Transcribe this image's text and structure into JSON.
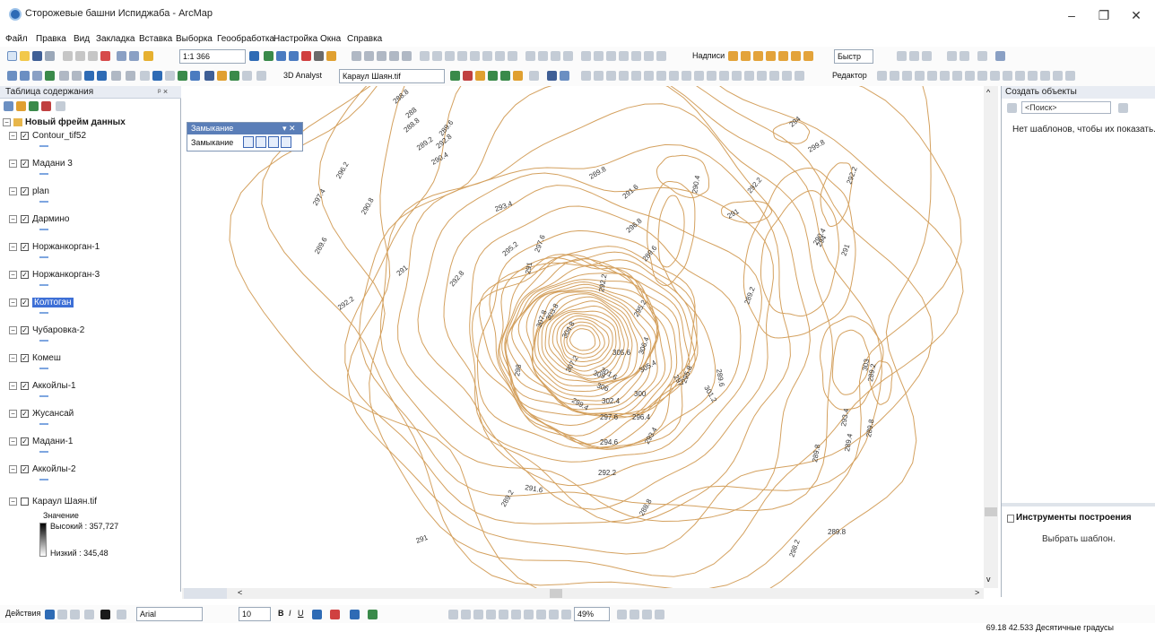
{
  "window": {
    "title": "Сторожевые башни Испиджаба - ArcMap",
    "minimize": "–",
    "maximize": "❐",
    "close": "✕"
  },
  "menu": [
    "Файл",
    "Правка",
    "Вид",
    "Закладка",
    "Вставка",
    "Выборка",
    "Геообработка",
    "Настройка",
    "Окна",
    "Справка"
  ],
  "toolbar": {
    "scale": "1:1 366",
    "labels_button": "Надписи",
    "quick_button": "Быстр",
    "analyst_3d": "3D Analyst",
    "raster_layer": "Караул Шаян.tif",
    "editor_button": "Редактор"
  },
  "toc": {
    "title": "Таблица содержания",
    "close": "ᵖ ×",
    "frame": "Новый фрейм данных",
    "layers": [
      {
        "name": "Contour_tif52"
      },
      {
        "name": "Мадани 3"
      },
      {
        "name": "plan"
      },
      {
        "name": "Дармино"
      },
      {
        "name": "Норжанкорган-1"
      },
      {
        "name": "Норжанкорган-3"
      },
      {
        "name": "Колтоган",
        "selected": true
      },
      {
        "name": "Чубаровка-2"
      },
      {
        "name": "Комеш"
      },
      {
        "name": "Аккойлы-1"
      },
      {
        "name": "Жусансай"
      },
      {
        "name": "Мадани-1"
      },
      {
        "name": "Аккойлы-2"
      }
    ],
    "raster": {
      "name": "Караул Шаян.tif",
      "value_label": "Значение",
      "high": "Высокий : 357,727",
      "low": "Низкий : 345,48"
    }
  },
  "snapping": {
    "title": "Замыкание",
    "label": "Замыкание",
    "close": "▾ ✕"
  },
  "right_panel": {
    "title": "Создать объекты",
    "search_placeholder": "<Поиск>",
    "no_templates": "Нет шаблонов, чтобы их показать.",
    "tools_title": "Инструменты построения",
    "tools_msg": "Выбрать шаблон."
  },
  "drawing": {
    "actions": "Действия",
    "font": "Arial",
    "size": "10",
    "zoom": "49%"
  },
  "status": {
    "coords": "69.18  42.533 Десятичные градусы"
  },
  "contour_labels": [
    "288.8",
    "288",
    "288.8",
    "289.2",
    "289.6",
    "290.4",
    "296.2",
    "297.4",
    "290.8",
    "289.6",
    "291",
    "292.2",
    "292.8",
    "293.4",
    "295.2",
    "292.8",
    "297.6",
    "291",
    "289.8",
    "291.6",
    "296.8",
    "289.6",
    "290.4",
    "291",
    "292.2",
    "294",
    "299.8",
    "289.2",
    "290.4",
    "291",
    "292.2",
    "295.2",
    "307.8",
    "303.8",
    "304.8",
    "306.4",
    "305.6",
    "301.6",
    "305.4",
    "309",
    "307.2",
    "306",
    "300",
    "302.4",
    "297",
    "295.8",
    "298",
    "289.6",
    "301.2",
    "299.4",
    "297.6",
    "296.4",
    "294.6",
    "293.4",
    "292.2",
    "291.6",
    "291",
    "289.2",
    "288.8",
    "289.8",
    "298.2",
    "289.8",
    "293.4",
    "303",
    "289.2",
    "289.8",
    "289.4",
    "294",
    "292.2"
  ],
  "colors": {
    "contour": "#d4a15f",
    "selection": "#3d6fd6"
  }
}
